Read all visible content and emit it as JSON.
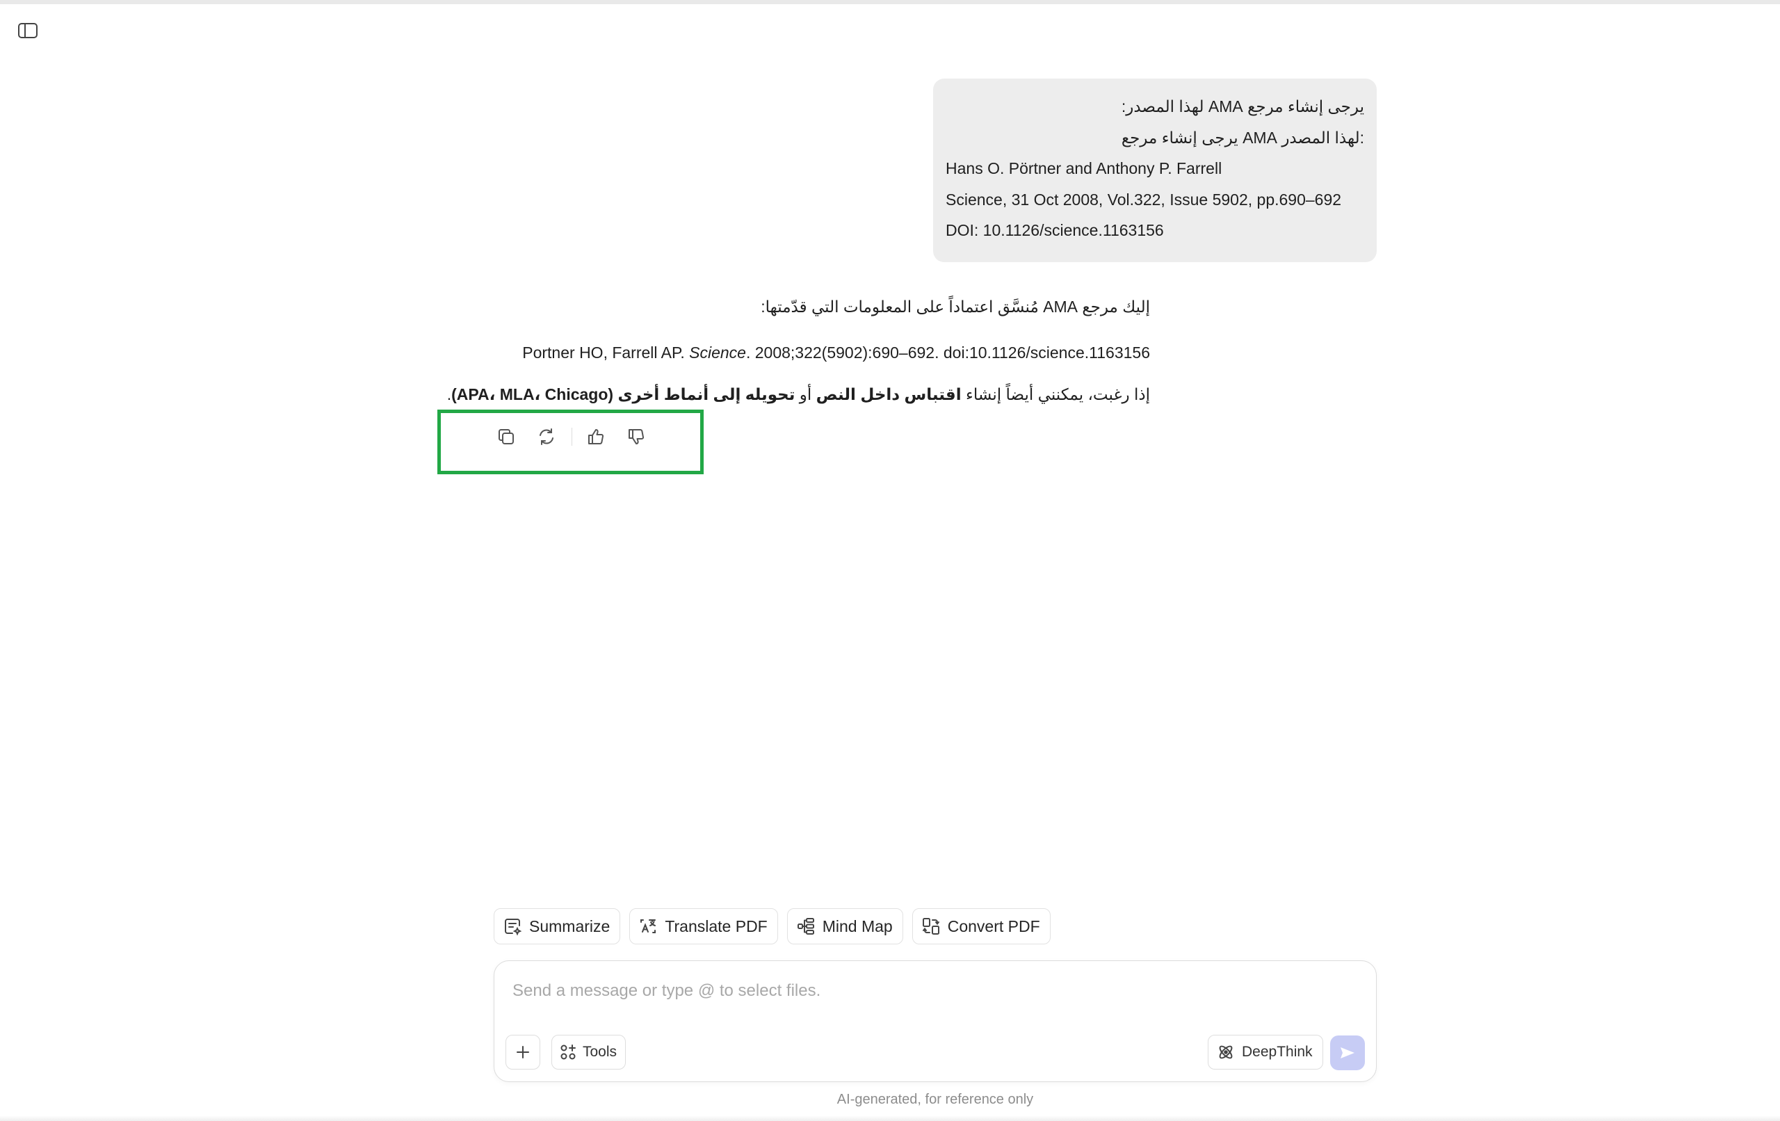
{
  "sidebar_toggle": {
    "icon": "sidebar-toggle-icon"
  },
  "user_message": {
    "lines": [
      "يرجى إنشاء مرجع AMA لهذا المصدر:",
      ":لهذا المصدر AMA يرجى إنشاء مرجع",
      "Hans O. Pörtner and Anthony P. Farrell",
      "Science, 31 Oct 2008, Vol.322, Issue 5902, pp.690–692",
      "DOI: 10.1126/science.1163156"
    ]
  },
  "assistant_message": {
    "intro": "إليك مرجع AMA مُنسَّق اعتماداً على المعلومات التي قدّمتها:",
    "citation_prefix": "Portner HO, Farrell AP. ",
    "citation_journal": "Science",
    "citation_suffix": ". 2008;322(5902):690–692. doi:10.1126/science.1163156",
    "followup_part1": "إذا رغبت، يمكنني أيضاً إنشاء ",
    "followup_bold1": "اقتباس داخل النص",
    "followup_part2": " أو ",
    "followup_bold2": "تحويله إلى أنماط أخرى (APA، MLA، Chicago)",
    "followup_end": "."
  },
  "actions": {
    "copy_icon": "copy-icon",
    "regenerate_icon": "regenerate-icon",
    "like_icon": "thumbs-up-icon",
    "dislike_icon": "thumbs-down-icon",
    "highlight_color": "#22a846"
  },
  "chips": [
    {
      "label": "Summarize",
      "icon": "summarize-icon"
    },
    {
      "label": "Translate PDF",
      "icon": "translate-icon"
    },
    {
      "label": "Mind Map",
      "icon": "mind-map-icon"
    },
    {
      "label": "Convert PDF",
      "icon": "convert-icon"
    }
  ],
  "composer": {
    "placeholder": "Send a message or type @ to select files.",
    "value": "",
    "tools_label": "Tools",
    "deepthink_label": "DeepThink",
    "send_color": "#c7ccf5"
  },
  "footer": {
    "note": "AI-generated, for reference only"
  }
}
